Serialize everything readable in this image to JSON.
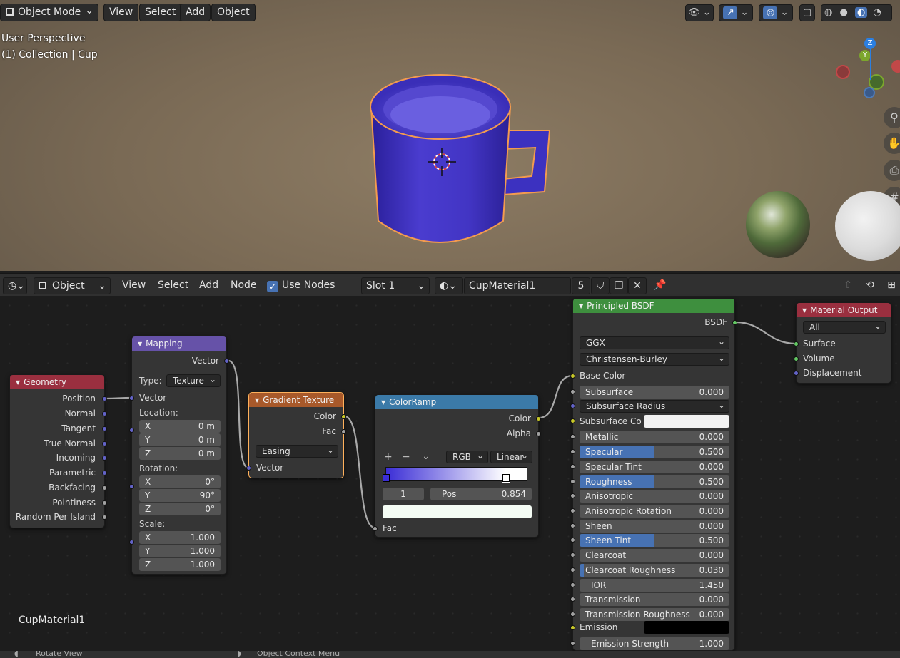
{
  "viewport": {
    "mode_label": "Object Mode",
    "menu": [
      "View",
      "Select",
      "Add",
      "Object"
    ],
    "info_line1": "User Perspective",
    "info_line2": "(1) Collection | Cup",
    "gizmo": {
      "z": "Z",
      "y": "Y"
    },
    "object_color": "#4a3ccf",
    "outline_color": "#f39b4f"
  },
  "node_header": {
    "editor_type_icon": "shader-editor-icon",
    "object_label": "Object",
    "menu": [
      "View",
      "Select",
      "Add",
      "Node"
    ],
    "use_nodes_label": "Use Nodes",
    "use_nodes_checked": true,
    "slot_label": "Slot 1",
    "material_name": "CupMaterial1",
    "user_count": "5"
  },
  "canvas_label": "CupMaterial1",
  "nodes": {
    "geometry": {
      "title": "Geometry",
      "outputs": [
        "Position",
        "Normal",
        "Tangent",
        "True Normal",
        "Incoming",
        "Parametric",
        "Backfacing",
        "Pointiness",
        "Random Per Island"
      ]
    },
    "mapping": {
      "title": "Mapping",
      "output": "Vector",
      "type_label": "Type:",
      "type_value": "Texture",
      "input_vector": "Vector",
      "location_label": "Location:",
      "location": [
        {
          "axis": "X",
          "value": "0 m"
        },
        {
          "axis": "Y",
          "value": "0 m"
        },
        {
          "axis": "Z",
          "value": "0 m"
        }
      ],
      "rotation_label": "Rotation:",
      "rotation": [
        {
          "axis": "X",
          "value": "0°"
        },
        {
          "axis": "Y",
          "value": "90°"
        },
        {
          "axis": "Z",
          "value": "0°"
        }
      ],
      "scale_label": "Scale:",
      "scale": [
        {
          "axis": "X",
          "value": "1.000"
        },
        {
          "axis": "Y",
          "value": "1.000"
        },
        {
          "axis": "Z",
          "value": "1.000"
        }
      ]
    },
    "gradient": {
      "title": "Gradient Texture",
      "out_color": "Color",
      "out_fac": "Fac",
      "type_value": "Easing",
      "input_vector": "Vector"
    },
    "colorramp": {
      "title": "ColorRamp",
      "out_color": "Color",
      "out_alpha": "Alpha",
      "add": "+",
      "remove": "−",
      "menu": "⌄",
      "color_mode": "RGB",
      "interpolation": "Linear",
      "active_index": "1",
      "pos_label": "Pos",
      "pos_value": "0.854",
      "input_fac": "Fac",
      "ramp_start_color": "#3b2ed6",
      "ramp_end_color": "#ffffff"
    },
    "bsdf": {
      "title": "Principled BSDF",
      "output": "BSDF",
      "distribution": "GGX",
      "subsurface_method": "Christensen-Burley",
      "base_color_label": "Base Color",
      "subsurface_radius": "Subsurface Radius",
      "subsurface_color_label": "Subsurface Co...",
      "emission_label": "Emission",
      "fields": [
        {
          "label": "Subsurface",
          "value": "0.000",
          "fill": 0
        },
        {
          "label": "Metallic",
          "value": "0.000",
          "fill": 0
        },
        {
          "label": "Specular",
          "value": "0.500",
          "fill": 0.5
        },
        {
          "label": "Specular Tint",
          "value": "0.000",
          "fill": 0
        },
        {
          "label": "Roughness",
          "value": "0.500",
          "fill": 0.5
        },
        {
          "label": "Anisotropic",
          "value": "0.000",
          "fill": 0
        },
        {
          "label": "Anisotropic Rotation",
          "value": "0.000",
          "fill": 0
        },
        {
          "label": "Sheen",
          "value": "0.000",
          "fill": 0
        },
        {
          "label": "Sheen Tint",
          "value": "0.500",
          "fill": 0.5
        },
        {
          "label": "Clearcoat",
          "value": "0.000",
          "fill": 0
        },
        {
          "label": "Clearcoat Roughness",
          "value": "0.030",
          "fill": 0.03
        },
        {
          "label": "IOR",
          "value": "1.450",
          "fill": 0
        },
        {
          "label": "Transmission",
          "value": "0.000",
          "fill": 0
        },
        {
          "label": "Transmission Roughness",
          "value": "0.000",
          "fill": 0
        }
      ],
      "emission_strength_label": "Emission Strength",
      "emission_strength_value": "1.000"
    },
    "output": {
      "title": "Material Output",
      "target": "All",
      "inputs": [
        "Surface",
        "Volume",
        "Displacement"
      ]
    }
  },
  "status_bar": {
    "left": "Rotate View",
    "right": "Object Context Menu"
  }
}
